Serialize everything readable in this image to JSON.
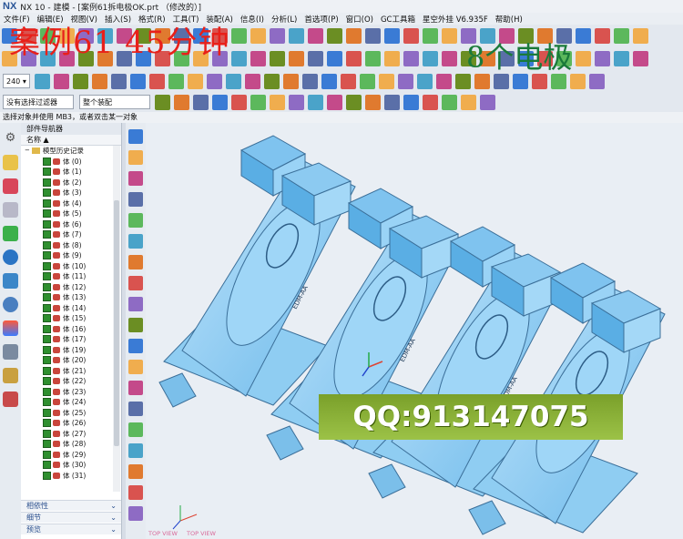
{
  "window": {
    "app_logo": "NX",
    "title": "NX 10 - 建模 - [案例61拆电极OK.prt （修改的）]"
  },
  "menu": [
    "文件(F)",
    "编辑(E)",
    "视图(V)",
    "插入(S)",
    "格式(R)",
    "工具(T)",
    "装配(A)",
    "信息(I)",
    "分析(L)",
    "首选项(P)",
    "窗口(O)",
    "GC工具箱",
    "星空外挂 V6.935F",
    "帮助(H)"
  ],
  "overlay": {
    "title_text": "案例61   45分钟",
    "subtitle_text": "8个电极",
    "qq_text": "QQ:913147075"
  },
  "toolbar": {
    "scale_value": "240",
    "filter_select": "没有选择过滤器",
    "assembly_select": "整个装配"
  },
  "status": {
    "prompt": "选择对象并使用 MB3，或者双击某一对象"
  },
  "navigator": {
    "title": "部件导航器",
    "column_name": "名称",
    "history_node": "模型历史记录",
    "items": [
      "体 (0)",
      "体 (1)",
      "体 (2)",
      "体 (3)",
      "体 (4)",
      "体 (5)",
      "体 (6)",
      "体 (7)",
      "体 (8)",
      "体 (9)",
      "体 (10)",
      "体 (11)",
      "体 (12)",
      "体 (13)",
      "体 (14)",
      "体 (15)",
      "体 (16)",
      "体 (17)",
      "体 (19)",
      "体 (20)",
      "体 (21)",
      "体 (22)",
      "体 (23)",
      "体 (24)",
      "体 (25)",
      "体 (26)",
      "体 (27)",
      "体 (28)",
      "体 (29)",
      "体 (30)",
      "体 (31)"
    ],
    "panels": [
      "相依性",
      "细节",
      "预览"
    ]
  },
  "viewport": {
    "view_label": "TOP VIEW",
    "part_label": "EDM-AA"
  }
}
